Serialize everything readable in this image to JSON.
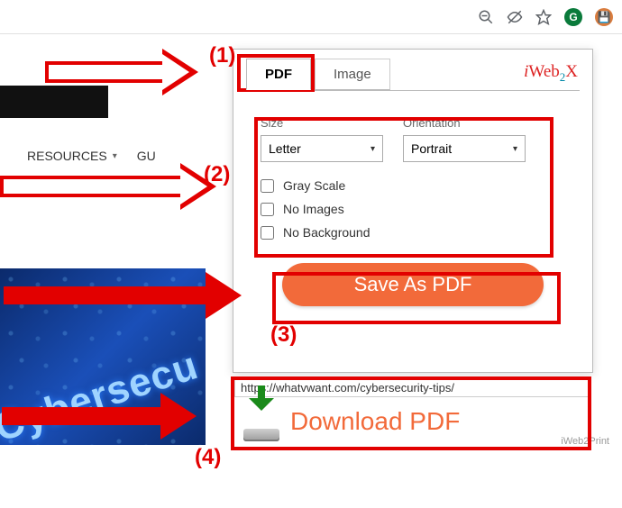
{
  "browser": {
    "ext1": "G",
    "ext2": "💾"
  },
  "page": {
    "nav_resources": "RESOURCES",
    "nav_guides_cut": "GU",
    "thumb_text": "Cybersecu"
  },
  "popup": {
    "brand_i": "i",
    "brand_web": "Web",
    "brand_two": "2",
    "brand_x": "X",
    "tabs": {
      "pdf": "PDF",
      "image": "Image"
    },
    "size_label": "Size",
    "orientation_label": "Orientation",
    "size_value": "Letter",
    "orientation_value": "Portrait",
    "chk_gray": "Gray Scale",
    "chk_noimg": "No Images",
    "chk_nobg": "No Background",
    "save_label": "Save As PDF"
  },
  "result": {
    "url": "https://whatvwant.com/cybersecurity-tips/",
    "download_label": "Download PDF",
    "watermark": "iWeb2Print"
  },
  "annotations": {
    "n1": "(1)",
    "n2": "(2)",
    "n3": "(3)",
    "n4": "(4)"
  }
}
